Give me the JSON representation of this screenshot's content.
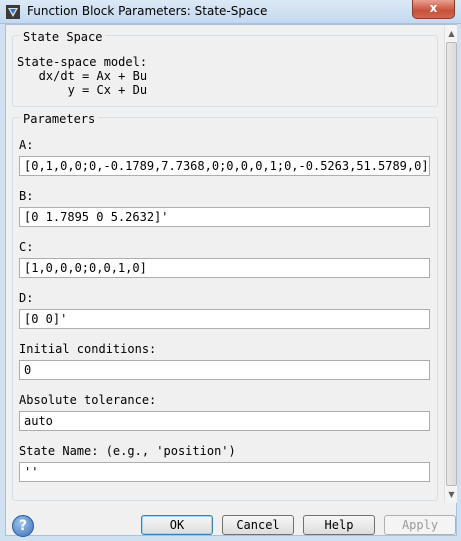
{
  "window": {
    "title": "Function Block Parameters: State-Space",
    "close_label": "x"
  },
  "block": {
    "group_title": "State Space",
    "description": "State-space model:\n   dx/dt = Ax + Bu\n       y = Cx + Du"
  },
  "parameters": {
    "group_title": "Parameters",
    "fields": [
      {
        "label": "A:",
        "value": "[0,1,0,0;0,-0.1789,7.7368,0;0,0,0,1;0,-0.5263,51.5789,0]"
      },
      {
        "label": "B:",
        "value": "[0 1.7895 0 5.2632]'"
      },
      {
        "label": "C:",
        "value": "[1,0,0,0;0,0,1,0]"
      },
      {
        "label": "D:",
        "value": "[0 0]'"
      },
      {
        "label": "Initial conditions:",
        "value": "0"
      },
      {
        "label": "Absolute tolerance:",
        "value": "auto"
      },
      {
        "label": "State Name: (e.g., 'position')",
        "value": "''"
      }
    ]
  },
  "buttons": {
    "help_icon": "?",
    "ok": "OK",
    "cancel": "Cancel",
    "help": "Help",
    "apply": "Apply"
  },
  "icons": {
    "app": "simulink-block-icon",
    "help": "help-circle-icon"
  }
}
